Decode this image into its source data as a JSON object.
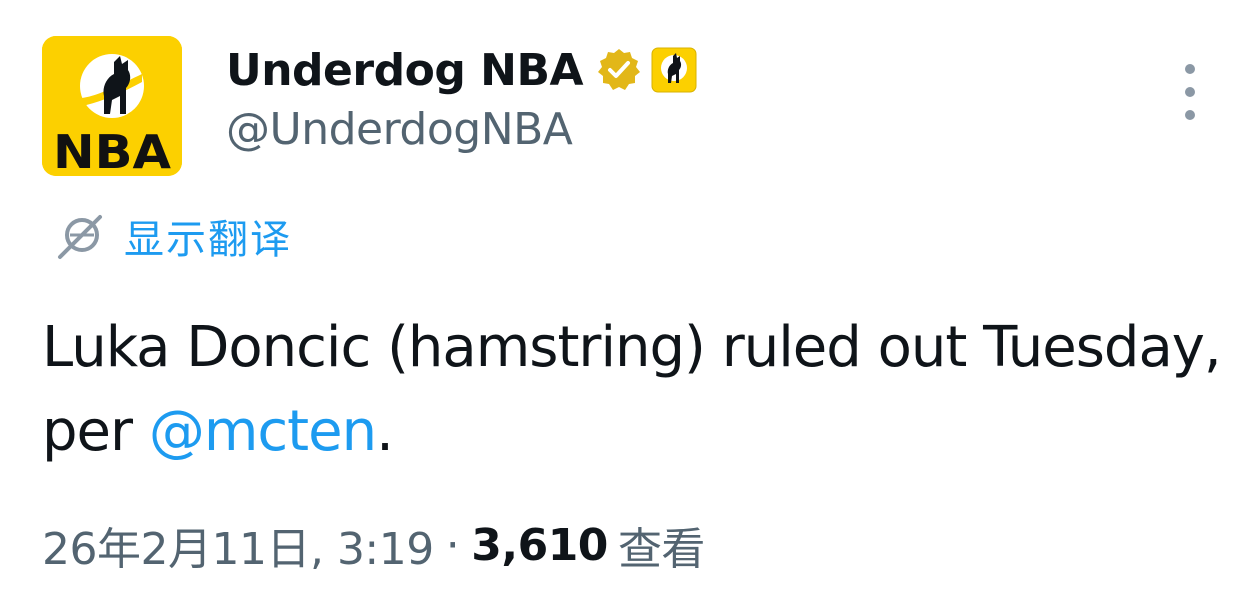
{
  "author": {
    "display_name": "Underdog NBA",
    "handle": "@UnderdogNBA",
    "avatar_text": "NBA",
    "brand_color": "#fcd000",
    "verified_badge": "gold-verified-check-icon",
    "affiliate_badge": "underdog-dog-icon"
  },
  "actions": {
    "more": "more-options-icon"
  },
  "translate": {
    "label": "显示翻译",
    "icon": "globe-translate-icon",
    "color": "#1d9bf0"
  },
  "tweet": {
    "text_before": "Luka Doncic (hamstring) ruled out Tuesday, per ",
    "mention": "@mcten",
    "text_after": "."
  },
  "meta": {
    "timestamp": "26年2月11日, 3:19",
    "separator": "·",
    "views_count": "3,610",
    "views_label": "查看"
  }
}
